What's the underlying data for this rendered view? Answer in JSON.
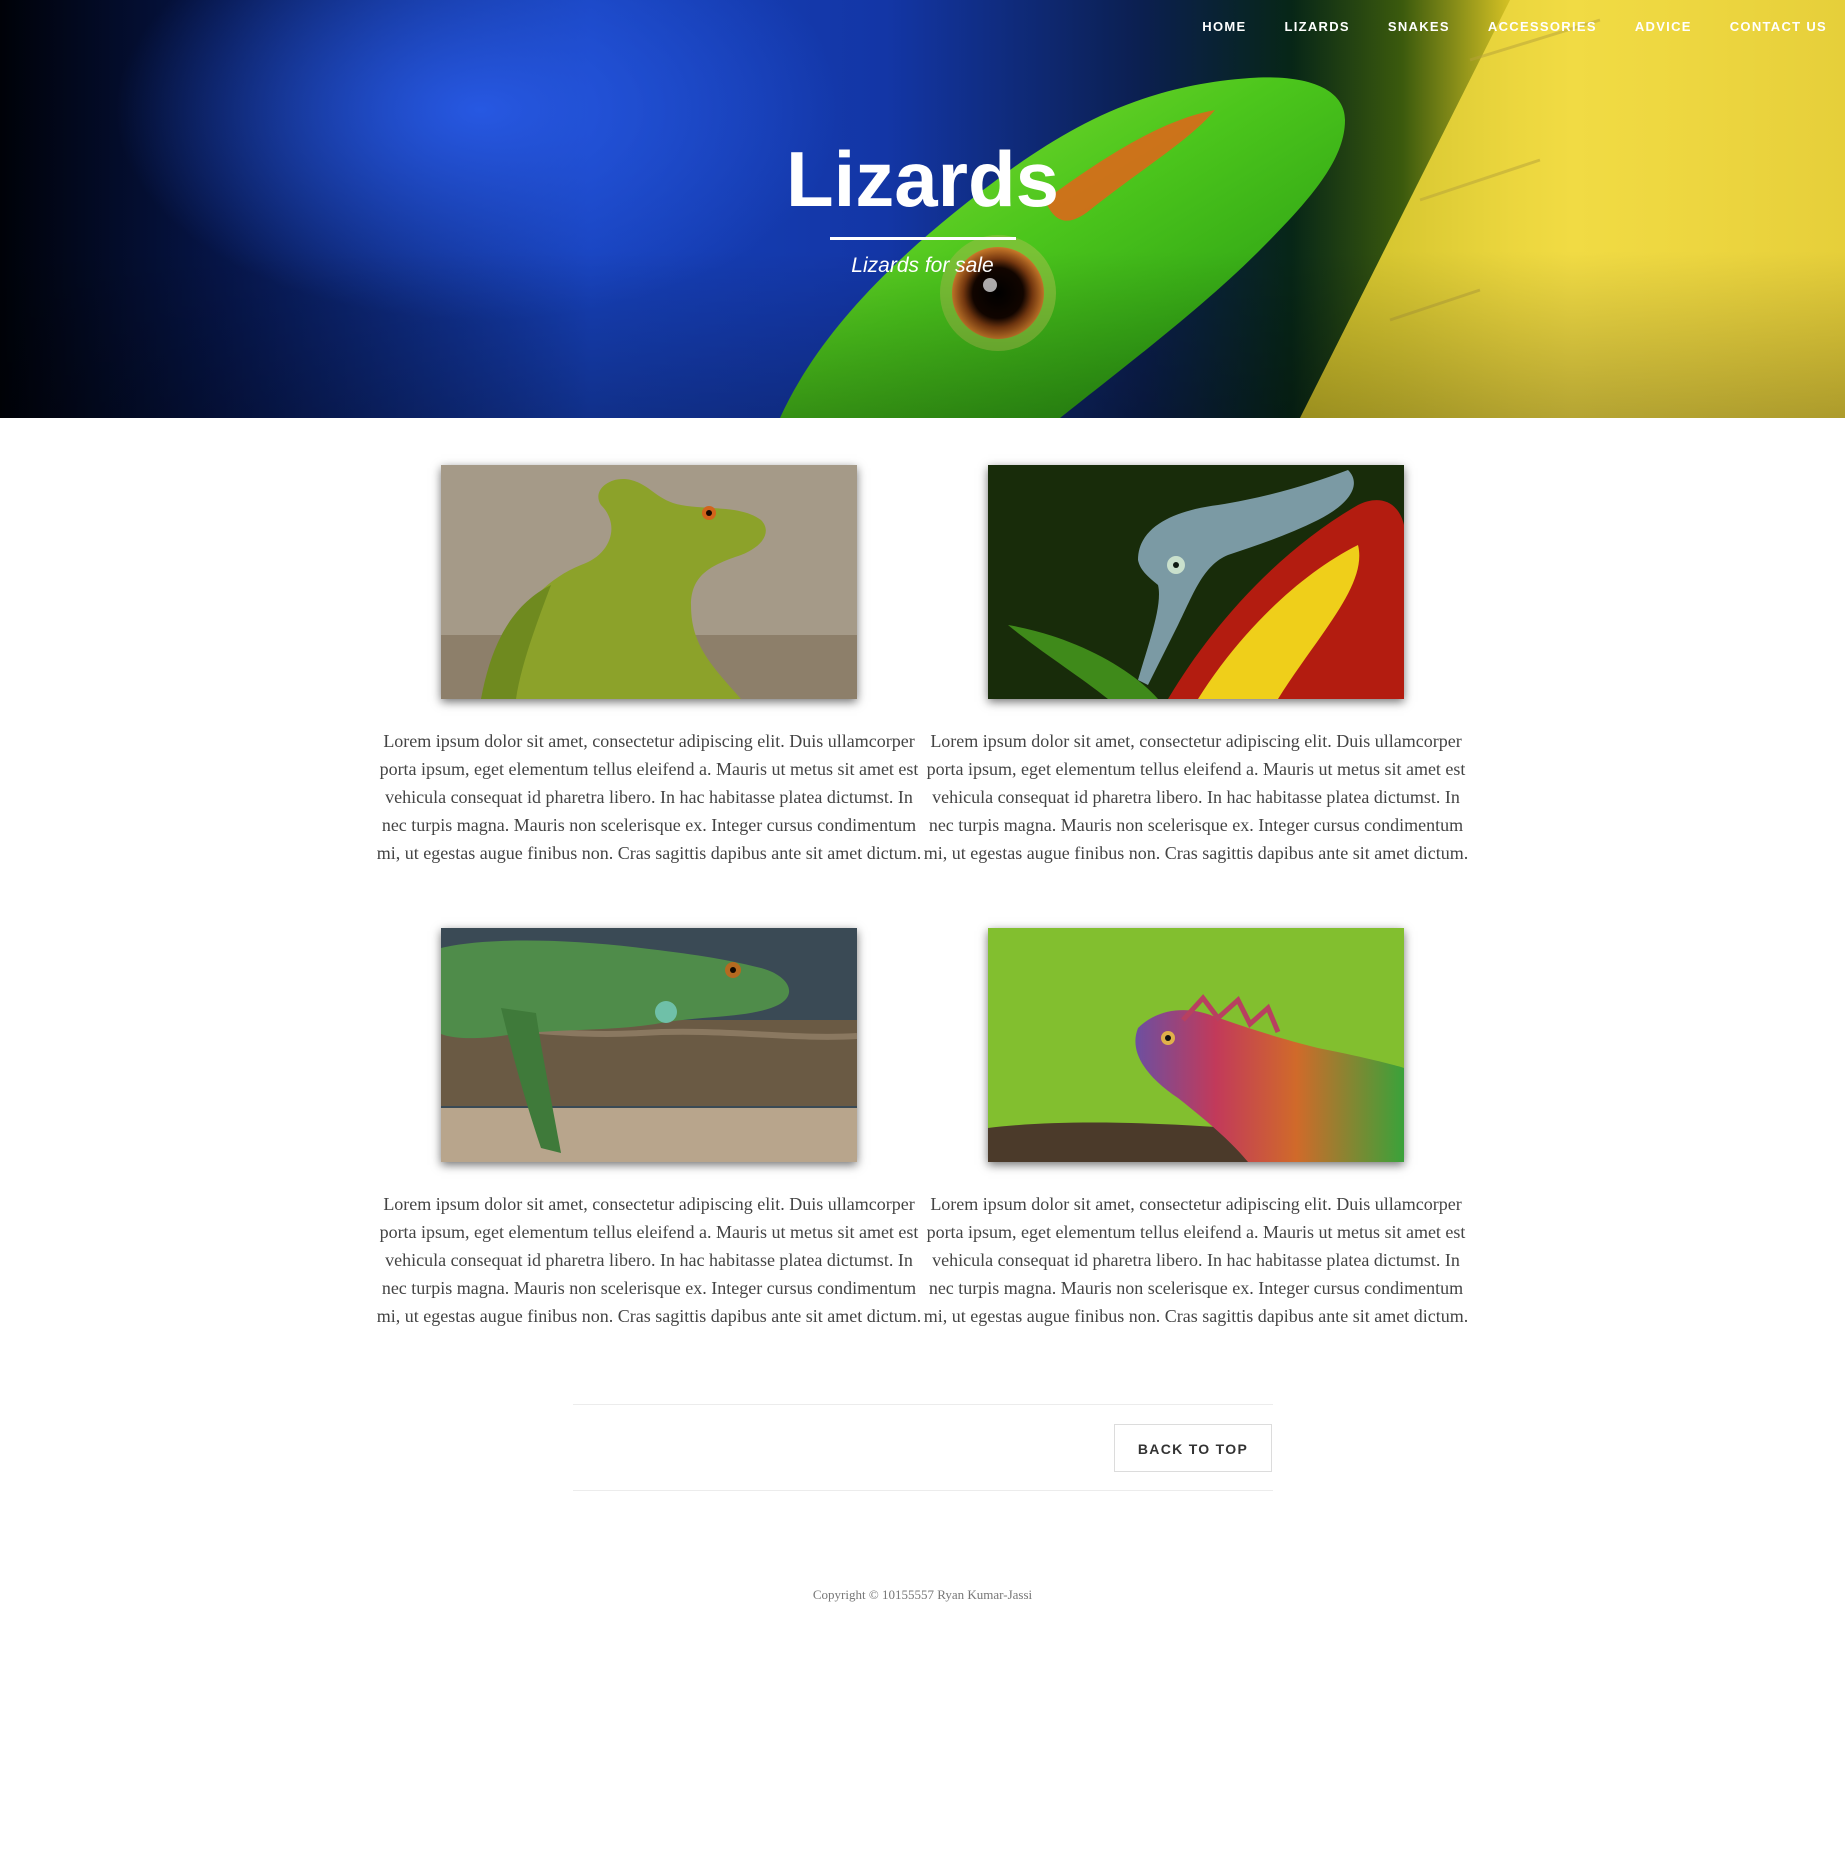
{
  "nav": {
    "items": [
      "HOME",
      "LIZARDS",
      "SNAKES",
      "ACCESSORIES",
      "ADVICE",
      "CONTACT US"
    ]
  },
  "hero": {
    "title": "Lizards",
    "subtitle": "Lizards for sale",
    "image": "gecko-eye-closeup"
  },
  "cards": [
    {
      "image": "green-basilisk",
      "text": "Lorem ipsum dolor sit amet, consectetur adipiscing elit. Duis ullamcorper porta ipsum, eget elementum tellus eleifend a. Mauris ut metus sit amet est vehicula consequat id pharetra libero. In hac habitasse platea dictumst. In nec turpis magna. Mauris non scelerisque ex. Integer cursus condimentum mi, ut egestas augue finibus non. Cras sagittis dapibus ante sit amet dictum."
    },
    {
      "image": "chameleon-on-flower",
      "text": "Lorem ipsum dolor sit amet, consectetur adipiscing elit. Duis ullamcorper porta ipsum, eget elementum tellus eleifend a. Mauris ut metus sit amet est vehicula consequat id pharetra libero. In hac habitasse platea dictumst. In nec turpis magna. Mauris non scelerisque ex. Integer cursus condimentum mi, ut egestas augue finibus non. Cras sagittis dapibus ante sit amet dictum."
    },
    {
      "image": "green-iguana-on-branch",
      "text": "Lorem ipsum dolor sit amet, consectetur adipiscing elit. Duis ullamcorper porta ipsum, eget elementum tellus eleifend a. Mauris ut metus sit amet est vehicula consequat id pharetra libero. In hac habitasse platea dictumst. In nec turpis magna. Mauris non scelerisque ex. Integer cursus condimentum mi, ut egestas augue finibus non. Cras sagittis dapibus ante sit amet dictum."
    },
    {
      "image": "rainbow-iguana-in-grass",
      "text": "Lorem ipsum dolor sit amet, consectetur adipiscing elit. Duis ullamcorper porta ipsum, eget elementum tellus eleifend a. Mauris ut metus sit amet est vehicula consequat id pharetra libero. In hac habitasse platea dictumst. In nec turpis magna. Mauris non scelerisque ex. Integer cursus condimentum mi, ut egestas augue finibus non. Cras sagittis dapibus ante sit amet dictum."
    }
  ],
  "back_to_top": "BACK TO TOP",
  "footer": {
    "copyright": "Copyright © 10155557 Ryan Kumar-Jassi"
  },
  "colors": {
    "hero_blue": "#1640b8",
    "hero_yellow": "#f1d93a",
    "lizard_green": "#57c81e",
    "body_text": "#444444"
  }
}
